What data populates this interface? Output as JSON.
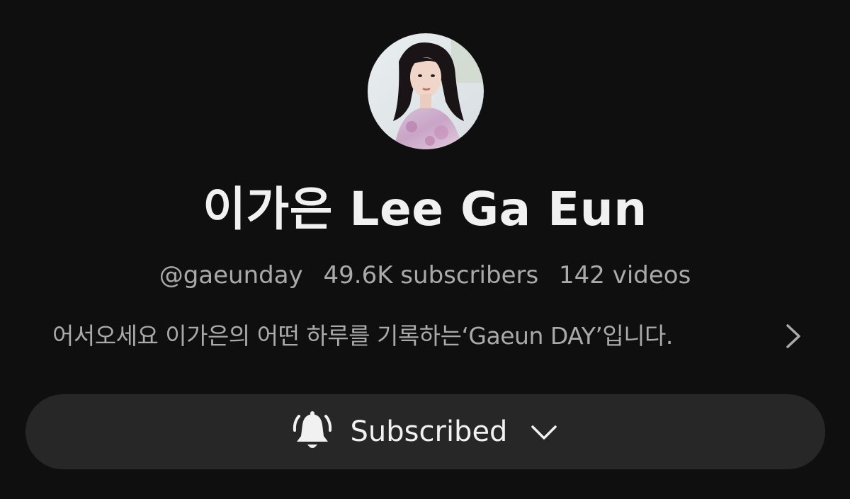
{
  "channel": {
    "name": "이가은 Lee Ga Eun",
    "handle": "@gaeunday",
    "subscribers": "49.6K subscribers",
    "videos": "142 videos",
    "description": "어서오세요 이가은의 어떤 하루를 기록하는‘Gaeun DAY’입니다.",
    "avatar_icon": "profile-photo"
  },
  "subscribe_button": {
    "label": "Subscribed",
    "icon": "bell-ring-icon",
    "dropdown_icon": "chevron-down-icon"
  },
  "description_more_icon": "chevron-right-icon",
  "colors": {
    "background": "#0f0f0f",
    "primary_text": "#f1f1f1",
    "secondary_text": "#aaaaaa",
    "button_background": "#272727"
  }
}
